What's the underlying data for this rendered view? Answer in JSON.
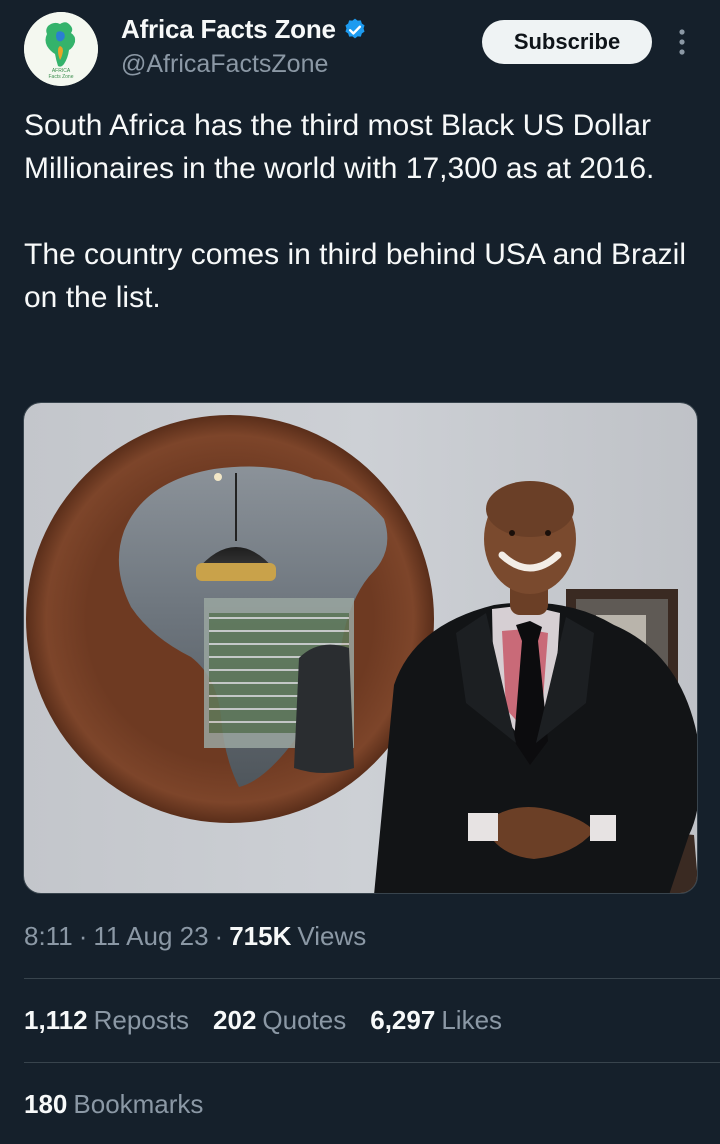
{
  "account": {
    "display_name": "Africa Facts Zone",
    "handle": "@AfricaFactsZone",
    "verified": true,
    "avatar_logo_text": "Africa Facts Zone"
  },
  "header": {
    "subscribe_label": "Subscribe",
    "more_icon": "vertical-ellipsis-icon"
  },
  "tweet": {
    "paragraphs": [
      "South Africa has the third most Black US Dollar Millionaires in the world with 17,300 as at 2016.",
      "The country comes in third behind USA and Brazil on the list."
    ]
  },
  "meta": {
    "time": "8:11",
    "date": "11 Aug 23",
    "views_count": "715K",
    "views_label": "Views"
  },
  "stats": {
    "reposts": {
      "count": "1,112",
      "label": "Reposts"
    },
    "quotes": {
      "count": "202",
      "label": "Quotes"
    },
    "likes": {
      "count": "6,297",
      "label": "Likes"
    },
    "bookmarks": {
      "count": "180",
      "label": "Bookmarks"
    }
  },
  "colors": {
    "background": "#15202b",
    "primary_text": "#f7f9f9",
    "secondary_text": "#8b98a5",
    "divider": "#38444d",
    "verified_badge": "#1d9bf0"
  }
}
